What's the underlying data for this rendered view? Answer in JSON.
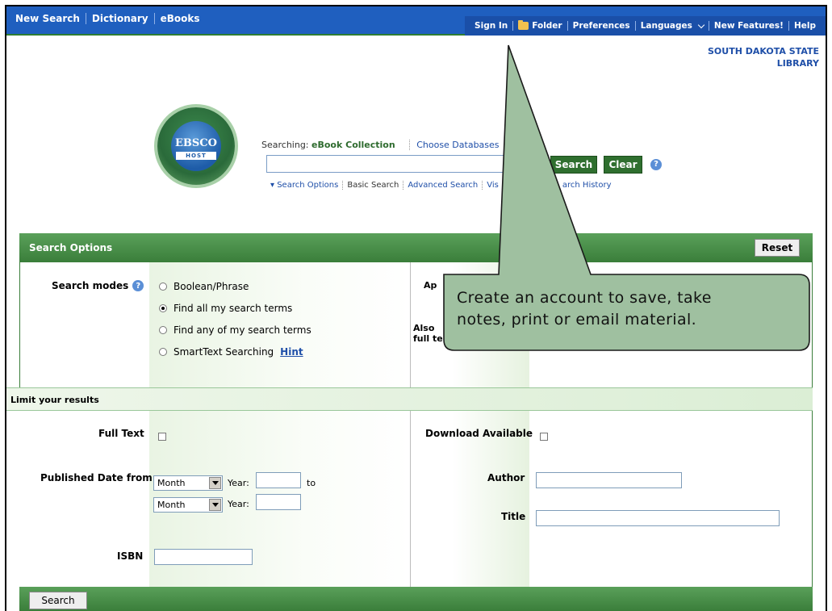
{
  "topnav": {
    "left": [
      "New Search",
      "Dictionary",
      "eBooks"
    ],
    "right": [
      "Sign In",
      "Folder",
      "Preferences",
      "Languages",
      "New Features!",
      "Help"
    ]
  },
  "library": {
    "line1": "SOUTH DAKOTA STATE",
    "line2": "LIBRARY"
  },
  "logo": {
    "main": "EBSCO",
    "sub": "HOST"
  },
  "search": {
    "searching_label": "Searching:",
    "collection": "eBook Collection",
    "choose_databases": "Choose Databases",
    "input_value": "",
    "search_button": "Search",
    "clear_button": "Clear",
    "sublinks": [
      "Search Options",
      "Basic Search",
      "Advanced Search",
      "Vis",
      "arch History"
    ]
  },
  "search_options": {
    "title": "Search Options",
    "reset": "Reset",
    "modes_label": "Search modes",
    "modes": [
      {
        "label": "Boolean/Phrase",
        "selected": false
      },
      {
        "label": "Find all my search terms",
        "selected": true
      },
      {
        "label": "Find any of my search terms",
        "selected": false
      },
      {
        "label": "SmartText Searching",
        "selected": false,
        "hint": "Hint"
      }
    ],
    "ap_fragment": "Ap",
    "also_fragment": "Also",
    "fullte_fragment": "full te"
  },
  "limits": {
    "title": "Limit your results",
    "full_text": "Full Text",
    "download_available": "Download Available",
    "published_date_from": "Published Date from",
    "month": "Month",
    "year": "Year:",
    "to": "to",
    "author": "Author",
    "title_label": "Title",
    "isbn": "ISBN"
  },
  "bottom": {
    "search_button": "Search"
  },
  "callout": {
    "line1": "Create an account to save, take",
    "line2": "notes, print or email material."
  },
  "colors": {
    "topbar": "#1f5fbf",
    "green": "#3a7e3a",
    "callout_fill": "#9fc0a0"
  }
}
